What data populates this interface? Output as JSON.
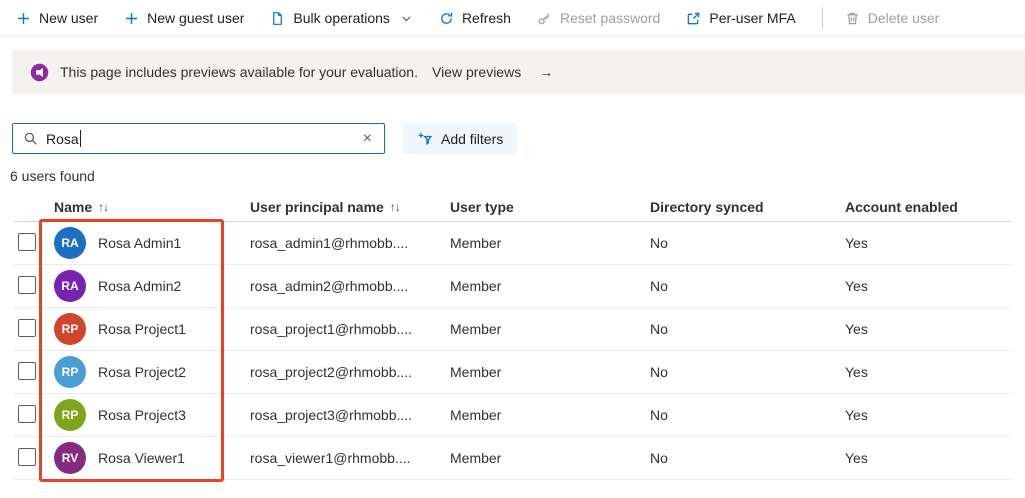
{
  "toolbar": {
    "items": [
      {
        "label": "New user",
        "icon": "plus-icon",
        "enabled": true
      },
      {
        "label": "New guest user",
        "icon": "plus-icon",
        "enabled": true
      },
      {
        "label": "Bulk operations",
        "icon": "document-icon",
        "enabled": true,
        "has_dropdown": true
      },
      {
        "label": "Refresh",
        "icon": "refresh-icon",
        "enabled": true
      },
      {
        "label": "Reset password",
        "icon": "key-icon",
        "enabled": false
      },
      {
        "label": "Per-user MFA",
        "icon": "external-link-icon",
        "enabled": true
      },
      {
        "label": "Delete user",
        "icon": "trash-icon",
        "enabled": false
      }
    ]
  },
  "banner": {
    "message": "This page includes previews available for your evaluation.",
    "link_label": "View previews",
    "arrow": "→"
  },
  "search": {
    "value": "Rosa",
    "clear_label": "×"
  },
  "filters": {
    "add_label": "Add filters"
  },
  "results_count": "6 users found",
  "table": {
    "columns": [
      {
        "label": "Name",
        "sort": "↑↓"
      },
      {
        "label": "User principal name",
        "sort": "↑↓"
      },
      {
        "label": "User type",
        "sort": ""
      },
      {
        "label": "Directory synced",
        "sort": ""
      },
      {
        "label": "Account enabled",
        "sort": ""
      }
    ],
    "rows": [
      {
        "initials": "RA",
        "avatar_color": "#1b6ec2",
        "name": "Rosa Admin1",
        "upn": "rosa_admin1@rhmobb....",
        "user_type": "Member",
        "directory_synced": "No",
        "account_enabled": "Yes"
      },
      {
        "initials": "RA",
        "avatar_color": "#7723b0",
        "name": "Rosa Admin2",
        "upn": "rosa_admin2@rhmobb....",
        "user_type": "Member",
        "directory_synced": "No",
        "account_enabled": "Yes"
      },
      {
        "initials": "RP",
        "avatar_color": "#d0452b",
        "name": "Rosa Project1",
        "upn": "rosa_project1@rhmobb....",
        "user_type": "Member",
        "directory_synced": "No",
        "account_enabled": "Yes"
      },
      {
        "initials": "RP",
        "avatar_color": "#4a9ed6",
        "name": "Rosa Project2",
        "upn": "rosa_project2@rhmobb....",
        "user_type": "Member",
        "directory_synced": "No",
        "account_enabled": "Yes"
      },
      {
        "initials": "RP",
        "avatar_color": "#7fa51c",
        "name": "Rosa Project3",
        "upn": "rosa_project3@rhmobb....",
        "user_type": "Member",
        "directory_synced": "No",
        "account_enabled": "Yes"
      },
      {
        "initials": "RV",
        "avatar_color": "#852b7f",
        "name": "Rosa Viewer1",
        "upn": "rosa_viewer1@rhmobb....",
        "user_type": "Member",
        "directory_synced": "No",
        "account_enabled": "Yes"
      }
    ]
  },
  "annotation": {
    "highlight_color": "#ea4227"
  },
  "colors": {
    "accent": "#0078d4",
    "disabled": "#a19f9d",
    "banner_icon": "#8a2da2",
    "filter_pill_bg": "#eff6fc"
  }
}
